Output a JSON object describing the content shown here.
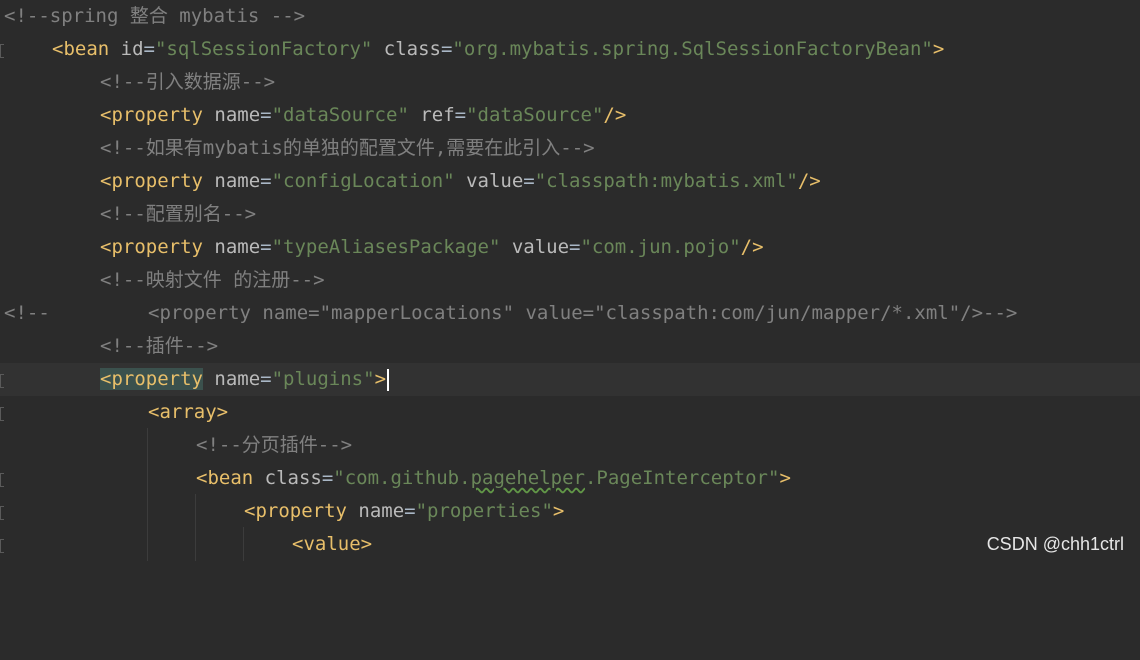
{
  "lines": [
    {
      "comment": "<!--spring 整合 mybatis -->"
    },
    {
      "tag_open": "<bean",
      "attrs": [
        {
          "name": " id",
          "value": "\"sqlSessionFactory\""
        },
        {
          "name": " class",
          "value": "\"org.mybatis.spring.SqlSessionFactoryBean\""
        }
      ],
      "tag_close": ">"
    },
    {
      "comment": "<!--引入数据源-->"
    },
    {
      "tag_open": "<property",
      "attrs": [
        {
          "name": " name",
          "value": "\"dataSource\""
        },
        {
          "name": " ref",
          "value": "\"dataSource\""
        }
      ],
      "tag_close": "/>"
    },
    {
      "comment": "<!--如果有mybatis的单独的配置文件,需要在此引入-->"
    },
    {
      "tag_open": "<property",
      "attrs": [
        {
          "name": " name",
          "value": "\"configLocation\""
        },
        {
          "name": " value",
          "value": "\"classpath:mybatis.xml\""
        }
      ],
      "tag_close": "/>"
    },
    {
      "comment": "<!--配置别名-->"
    },
    {
      "tag_open": "<property",
      "attrs": [
        {
          "name": " name",
          "value": "\"typeAliasesPackage\""
        },
        {
          "name": " value",
          "value": "\"com.jun.pojo\""
        }
      ],
      "tag_close": "/>"
    },
    {
      "comment": "<!--映射文件 的注册-->"
    },
    {
      "comment_prefix": "<!--",
      "comment": "<property name=\"mapperLocations\" value=\"classpath:com/jun/mapper/*.xml\"/>-->"
    },
    {
      "comment": "<!--插件-->"
    },
    {
      "tag_open": "<property",
      "attrs": [
        {
          "name": " name",
          "value": "\"plugins\""
        }
      ],
      "tag_close": ">"
    },
    {
      "tag_open": "<array",
      "attrs": [],
      "tag_close": ">"
    },
    {
      "comment": "<!--分页插件-->"
    },
    {
      "tag_open": "<bean",
      "attr_name": " class",
      "val_part1": "\"com.github.",
      "val_typo": "pagehelper",
      "val_part2": ".PageInterceptor\"",
      "tag_close": ">"
    },
    {
      "tag_open": "<property",
      "attrs": [
        {
          "name": " name",
          "value": "\"properties\""
        }
      ],
      "tag_close": ">"
    },
    {
      "tag_open": "<value",
      "attrs": [],
      "tag_close": ">"
    }
  ],
  "watermark": "CSDN @chh1ctrl",
  "colors": {
    "background": "#2b2b2b",
    "tag": "#e8bf6a",
    "attribute": "#bababa",
    "string": "#6a8759",
    "comment": "#808080",
    "current_line": "#323232",
    "tag_highlight": "#3b514d"
  }
}
